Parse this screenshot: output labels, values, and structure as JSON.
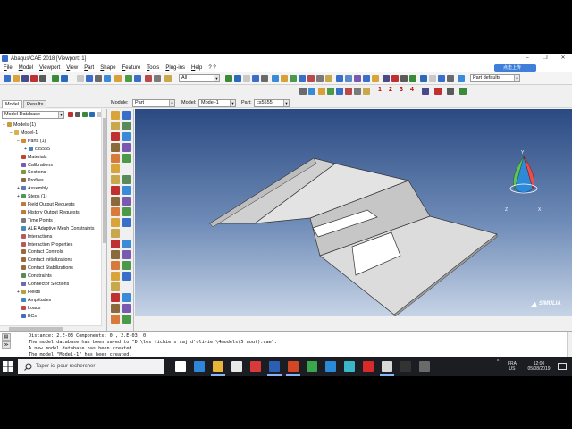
{
  "window": {
    "title": "Abaqus/CAE 2018 [Viewport: 1]",
    "controls": [
      "–",
      "❐",
      "✕"
    ]
  },
  "menu": [
    "File",
    "Model",
    "Viewport",
    "View",
    "Part",
    "Shape",
    "Feature",
    "Tools",
    "Plug-ins",
    "Help",
    "? ?"
  ],
  "upload_badge": "点击上传",
  "toolbar": {
    "render_combo": "All",
    "part_defaults_combo": "Part defaults",
    "numbers": [
      "1",
      "2",
      "3",
      "4"
    ]
  },
  "context": {
    "module_label": "Module:",
    "module_value": "Part",
    "model_label": "Model:",
    "model_value": "Model-1",
    "part_label": "Part:",
    "part_value": "cs5555"
  },
  "tree": {
    "tabs": [
      "Model",
      "Results"
    ],
    "database_combo": "Model Database",
    "items": [
      {
        "label": "Models (1)",
        "indent": 0,
        "expander": "−",
        "color": "#c89a3c"
      },
      {
        "label": "Model-1",
        "indent": 1,
        "expander": "−",
        "color": "#d8b34a"
      },
      {
        "label": "Parts (1)",
        "indent": 2,
        "expander": "−",
        "color": "#d28b2f"
      },
      {
        "label": "cs5555",
        "indent": 3,
        "expander": "+",
        "color": "#4a7fc4"
      },
      {
        "label": "Materials",
        "indent": 2,
        "expander": "",
        "color": "#c0452c"
      },
      {
        "label": "Calibrations",
        "indent": 2,
        "expander": "",
        "color": "#7c5ab0"
      },
      {
        "label": "Sections",
        "indent": 2,
        "expander": "",
        "color": "#7c9a3c"
      },
      {
        "label": "Profiles",
        "indent": 2,
        "expander": "",
        "color": "#8a6a4a"
      },
      {
        "label": "Assembly",
        "indent": 2,
        "expander": "+",
        "color": "#5a7ab8"
      },
      {
        "label": "Steps (1)",
        "indent": 2,
        "expander": "+",
        "color": "#4a9a5a"
      },
      {
        "label": "Field Output Requests",
        "indent": 2,
        "expander": "",
        "color": "#c07a3a"
      },
      {
        "label": "History Output Requests",
        "indent": 2,
        "expander": "",
        "color": "#c07a3a"
      },
      {
        "label": "Time Points",
        "indent": 2,
        "expander": "",
        "color": "#7a7a7a"
      },
      {
        "label": "ALE Adaptive Mesh Constraints",
        "indent": 2,
        "expander": "",
        "color": "#4a8ab8"
      },
      {
        "label": "Interactions",
        "indent": 2,
        "expander": "",
        "color": "#b85a5a"
      },
      {
        "label": "Interaction Properties",
        "indent": 2,
        "expander": "",
        "color": "#b85a5a"
      },
      {
        "label": "Contact Controls",
        "indent": 2,
        "expander": "",
        "color": "#9a6a3a"
      },
      {
        "label": "Contact Initializations",
        "indent": 2,
        "expander": "",
        "color": "#9a6a3a"
      },
      {
        "label": "Contact Stabilizations",
        "indent": 2,
        "expander": "",
        "color": "#9a6a3a"
      },
      {
        "label": "Constraints",
        "indent": 2,
        "expander": "",
        "color": "#5a8a5a"
      },
      {
        "label": "Connector Sections",
        "indent": 2,
        "expander": "",
        "color": "#6a6ab0"
      },
      {
        "label": "Fields",
        "indent": 2,
        "expander": "+",
        "color": "#b8a03a"
      },
      {
        "label": "Amplitudes",
        "indent": 2,
        "expander": "",
        "color": "#3a8ab8"
      },
      {
        "label": "Loads",
        "indent": 2,
        "expander": "",
        "color": "#c04a4a"
      },
      {
        "label": "BCs",
        "indent": 2,
        "expander": "",
        "color": "#4a6ac0"
      }
    ]
  },
  "viewport": {
    "triad_labels": {
      "y": "Y",
      "z": "Z",
      "x": "X"
    },
    "compass_labels": {
      "top": "Y",
      "left": "Z",
      "right": "X"
    },
    "logo_text": "SIMULIA"
  },
  "messages": [
    "   Distance:  2.E-03  Components:  0.,  2.E-03,  0.",
    "The model database has been saved to \"D:\\les fichiers caj'd'olivier\\4models(5 aout).cae\".",
    "A new model database has been created.",
    "The model \"Model-1\" has been created."
  ],
  "taskbar": {
    "search_placeholder": "Taper ici pour rechercher",
    "lang_top": "FRA",
    "lang_bottom": "US",
    "time": "12:00",
    "date": "05/08/2019",
    "apps": [
      {
        "name": "task-view",
        "color": "#ffffff"
      },
      {
        "name": "edge",
        "color": "#2f86d8"
      },
      {
        "name": "explorer",
        "color": "#e8b43a"
      },
      {
        "name": "store",
        "color": "#e8e8e8"
      },
      {
        "name": "media",
        "color": "#d83a3a"
      },
      {
        "name": "word",
        "color": "#2b5fb4"
      },
      {
        "name": "powerpoint",
        "color": "#d24726"
      },
      {
        "name": "chrome",
        "color": "#3aa84a"
      },
      {
        "name": "app-blue",
        "color": "#2a8ad8"
      },
      {
        "name": "app-cyan",
        "color": "#3ab8c8"
      },
      {
        "name": "acrobat",
        "color": "#d82a2a"
      },
      {
        "name": "abaqus",
        "color": "#d8d8d8"
      },
      {
        "name": "cmd",
        "color": "#333333"
      },
      {
        "name": "app-gray",
        "color": "#6a6a6a"
      }
    ]
  }
}
